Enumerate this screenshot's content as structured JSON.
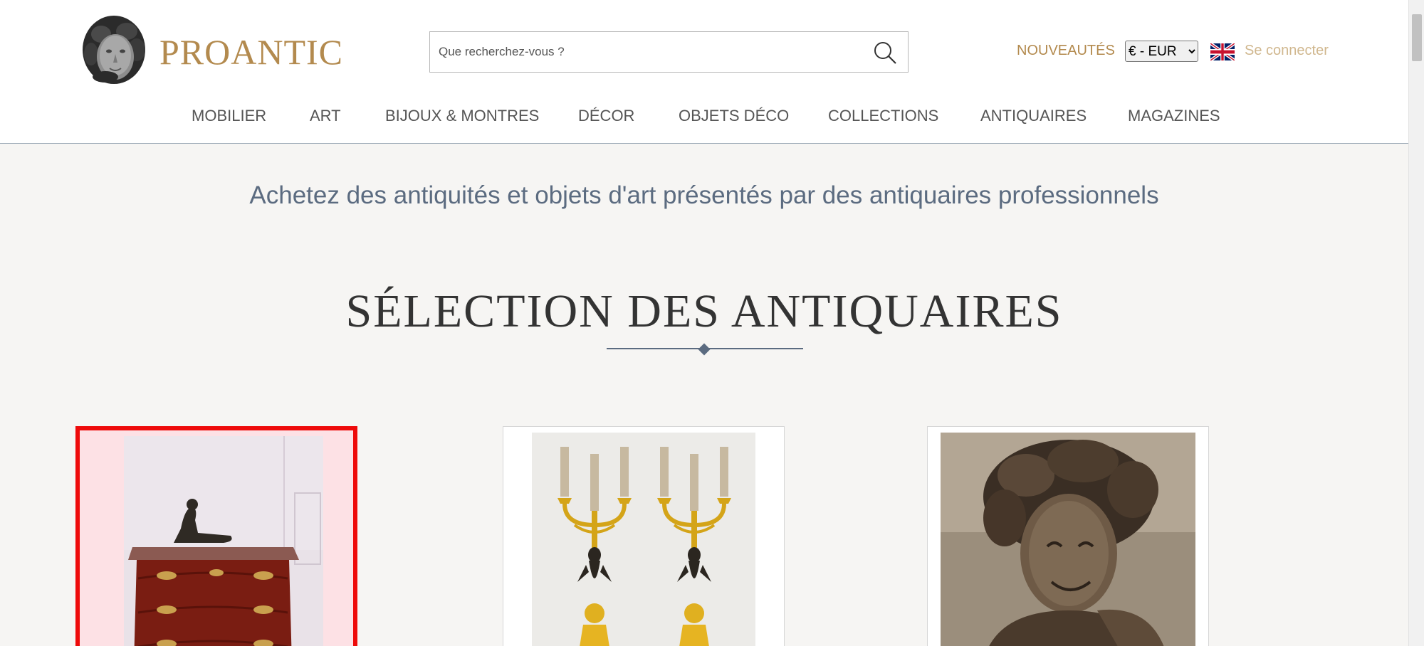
{
  "header": {
    "brand": "PROANTIC",
    "search": {
      "placeholder": "Que recherchez-vous ?",
      "value": ""
    },
    "new_label": "NOUVEAUTÉS",
    "currency": {
      "selected": "€ - EUR",
      "options": [
        "€ - EUR"
      ]
    },
    "language_icon": "uk-flag-icon",
    "login_label": "Se connecter"
  },
  "nav": {
    "items": [
      {
        "label": "MOBILIER"
      },
      {
        "label": "ART"
      },
      {
        "label": "BIJOUX & MONTRES"
      },
      {
        "label": "DÉCOR"
      },
      {
        "label": "OBJETS DÉCO"
      },
      {
        "label": "COLLECTIONS"
      },
      {
        "label": "ANTIQUAIRES"
      },
      {
        "label": "MAGAZINES"
      }
    ]
  },
  "main": {
    "tagline": "Achetez des antiquités et objets d'art présentés par des antiquaires professionnels",
    "section_title": "SÉLECTION DES ANTIQUAIRES",
    "cards": [
      {
        "image": "commode-with-bronze-sculpture",
        "selected": true
      },
      {
        "image": "pair-of-gilt-bronze-candelabras",
        "selected": false
      },
      {
        "image": "bronze-bust-of-bacchante",
        "selected": false
      }
    ]
  },
  "colors": {
    "brand_gold": "#b38a4e",
    "accent_blue_gray": "#5b6b80",
    "selection_red": "#ee0a0a",
    "page_background": "#f6f5f3"
  }
}
